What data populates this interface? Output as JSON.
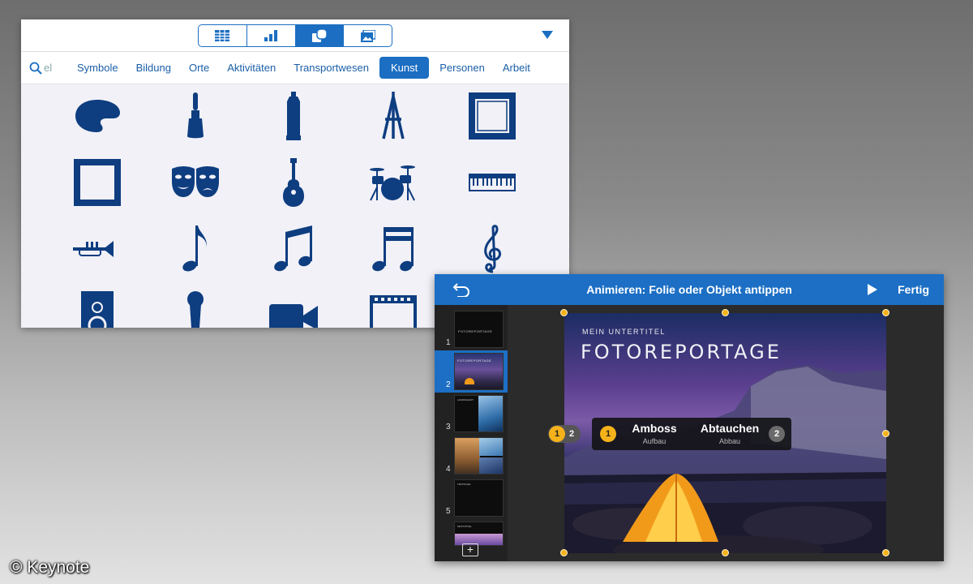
{
  "library": {
    "view_tabs": [
      "table-icon",
      "chart-icon",
      "shapes-icon",
      "media-icon"
    ],
    "selected_view_tab": 2,
    "search_text": "el",
    "categories": [
      "Symbole",
      "Bildung",
      "Orte",
      "Aktivitäten",
      "Transportwesen",
      "Kunst",
      "Personen",
      "Arbeit"
    ],
    "active_category": "Kunst",
    "icon_color": "#0e3d80",
    "accent_color": "#1b6ec2",
    "shapes": [
      "palette-icon",
      "paintbrush-icon",
      "paint-tube-icon",
      "easel-icon",
      "frame-icon",
      "ornate-frame-icon",
      "theater-masks-icon",
      "guitar-icon",
      "drum-kit-icon",
      "keyboard-icon",
      "trumpet-icon",
      "eighth-note-icon",
      "beamed-notes-icon",
      "sixteenth-notes-icon",
      "treble-clef-icon",
      "speaker-icon",
      "microphone-icon",
      "video-camera-icon",
      "film-strip-icon"
    ]
  },
  "keynote": {
    "title": "Animieren: Folie oder Objekt antippen",
    "done_label": "Fertig",
    "accent_color": "#1c6fc4",
    "slides": [
      {
        "number": "1",
        "caption": "FOTOREPORTAGE"
      },
      {
        "number": "2",
        "caption": "FOTOREPORTAGE"
      },
      {
        "number": "3",
        "caption": "LANDSCHAFT"
      },
      {
        "number": "4",
        "caption": ""
      },
      {
        "number": "5",
        "caption": "TEXTFOLIE"
      },
      {
        "number": "",
        "caption": "MOTIVTITEL"
      }
    ],
    "selected_slide": 2,
    "slide": {
      "subtitle": "MEIN UNTERTITEL",
      "title": "FOTOREPORTAGE"
    },
    "animation": {
      "build_in_order": "1",
      "build_in_name": "Amboss",
      "build_in_type": "Aufbau",
      "build_out_order": "2",
      "build_out_name": "Abtauchen",
      "build_out_type": "Abbau",
      "badge_left": "1",
      "badge_right": "2"
    }
  },
  "credit": "© Keynote"
}
